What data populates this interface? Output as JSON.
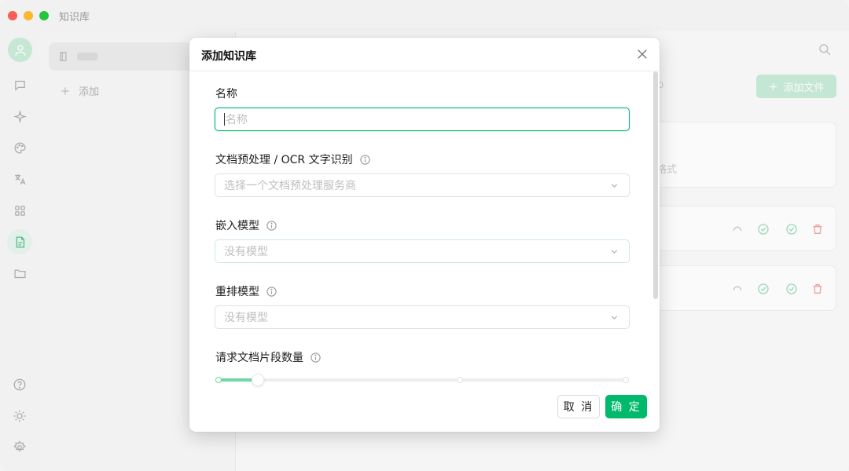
{
  "app": {
    "title": "知识库"
  },
  "colors": {
    "accent": "#00b96b",
    "danger": "#f08080"
  },
  "sidebar": {
    "icons": [
      "user-avatar",
      "chat-icon",
      "sparkle-icon",
      "palette-icon",
      "translate-icon",
      "apps-icon",
      "knowledge-icon",
      "folder-icon",
      "help-icon",
      "theme-icon",
      "settings-icon"
    ],
    "active": "knowledge-icon"
  },
  "kb_list": {
    "add_label": "添加"
  },
  "main": {
    "add_file_label": "添加文件",
    "format_hint": "格式",
    "truncated_text": "0"
  },
  "dialog": {
    "title": "添加知识库",
    "name": {
      "label": "名称",
      "placeholder": "名称",
      "value": ""
    },
    "preprocess": {
      "label": "文档预处理 / OCR 文字识别",
      "placeholder": "选择一个文档预处理服务商"
    },
    "embedding": {
      "label": "嵌入模型",
      "placeholder": "没有模型"
    },
    "rerank": {
      "label": "重排模型",
      "placeholder": "没有模型"
    },
    "chunks": {
      "label": "请求文档片段数量",
      "value_fraction": 0.1
    },
    "cancel_label": "取 消",
    "ok_label": "确 定"
  }
}
